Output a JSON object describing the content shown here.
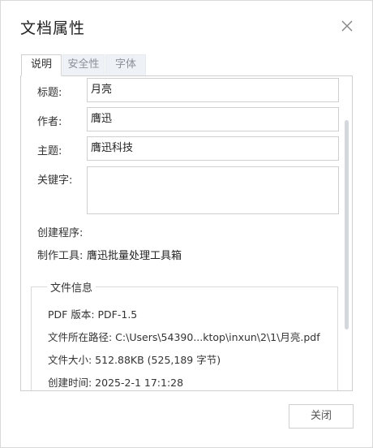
{
  "dialog": {
    "title": "文档属性",
    "close_icon": "close-icon"
  },
  "tabs": [
    {
      "label": "说明",
      "active": true
    },
    {
      "label": "安全性",
      "active": false
    },
    {
      "label": "字体",
      "active": false
    }
  ],
  "description": {
    "title_label": "标题:",
    "title_value": "月亮",
    "author_label": "作者:",
    "author_value": "膺迅",
    "subject_label": "主题:",
    "subject_value": "膺迅科技",
    "keywords_label": "关键字:",
    "keywords_value": "",
    "creator_label": "创建程序:",
    "creator_value": "",
    "producer_label": "制作工具:",
    "producer_value": "膺迅批量处理工具箱"
  },
  "file_info": {
    "legend": "文件信息",
    "pdf_version": "PDF 版本: PDF-1.5",
    "path": "文件所在路径: C:\\Users\\54390...ktop\\inxun\\2\\1\\月亮.pdf",
    "size": "文件大小: 512.88KB (525,189 字节)",
    "created": "创建时间: 2025-2-1 17:1:28"
  },
  "footer": {
    "close_label": "关闭"
  },
  "colors": {
    "border": "#cfcfcf",
    "tab_inactive_bg": "#eef1f5",
    "scroll_thumb": "#d4d7dc"
  }
}
